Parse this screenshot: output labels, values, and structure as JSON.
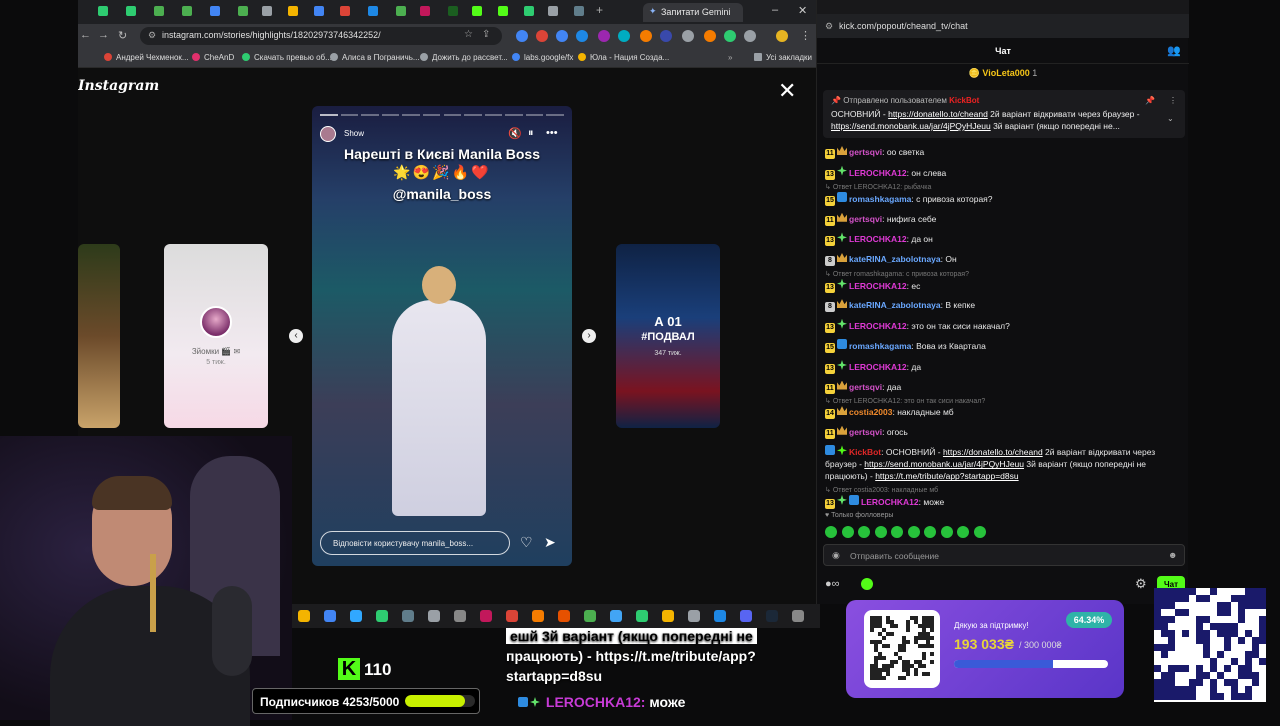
{
  "browser": {
    "active_tab": "Запитати Gemini",
    "url": "instagram.com/stories/highlights/18202973746342252/",
    "bookmarks": [
      "Андрей Чехменок...",
      "CheAnD",
      "Скачать превью об...",
      "Алиса в Пограничь...",
      "Дожить до рассвет...",
      "labs.google/fx",
      "Юла - Нация Созда...",
      "Усі закладки"
    ]
  },
  "instagram": {
    "logo": "Instagram",
    "close_icon": "close-icon",
    "left_preview": {
      "title": "Зйомки 🎬 ✉",
      "time": "5 тиж."
    },
    "right_preview": {
      "poster_line1": "А 01",
      "poster_line2": "#ПОДВАЛ",
      "time": "347 тиж."
    },
    "story": {
      "user": "Show",
      "title": "Нарешті в Києві Manila Boss",
      "emoji": "🌟😍🎉🔥❤️",
      "mention": "@manila_boss",
      "reply_placeholder": "Відповісти користувачу manila_boss...",
      "progress": {
        "segments": 12,
        "current": 1
      }
    }
  },
  "chat": {
    "chrome_url": "kick.com/popout/cheand_tv/chat",
    "header": "Чат",
    "gifter": {
      "name": "VioLeta000",
      "count": "1"
    },
    "pinned": {
      "by": "Отправлено пользователем",
      "bot": "KickBot",
      "text_main": "ОСНОВНИЙ - ",
      "link1": "https://donatello.to/cheand",
      "text_mid": " 2й варіант відкривати через браузер - ",
      "link2": "https://send.monobank.ua/jar/4jPQyHJeuu",
      "text_end": " 3й варіант (якщо попередні не..."
    },
    "messages": [
      {
        "badge": "11",
        "badge_color": "#f5d13a",
        "badge2": "crown",
        "user": "gertsqvi",
        "color": "#d452c9",
        "text": "оо светка"
      },
      {
        "badge": "13",
        "badge_color": "#f5d13a",
        "badge2": "star",
        "user": "LEROCHKA12",
        "color": "#e03ad6",
        "text": "он слева"
      },
      {
        "reply": "Ответ LEROCHKA12: рыбачка",
        "badge": "15",
        "badge_color": "#f5d13a",
        "badge2": "blue",
        "user": "romashkagama",
        "color": "#6aa8ff",
        "text": "с привоза которая?"
      },
      {
        "badge": "11",
        "badge_color": "#f5d13a",
        "badge2": "crown",
        "user": "gertsqvi",
        "color": "#d452c9",
        "text": "нифига себе"
      },
      {
        "badge": "13",
        "badge_color": "#f5d13a",
        "badge2": "star",
        "user": "LEROCHKA12",
        "color": "#e03ad6",
        "text": "да он"
      },
      {
        "badge": "8",
        "badge_color": "#cccccc",
        "badge2": "crown",
        "user": "kateRINA_zabolotnaya",
        "color": "#6aa8ff",
        "text": "Он"
      },
      {
        "reply": "Ответ romashkagama: с привоза которая?",
        "badge": "13",
        "badge_color": "#f5d13a",
        "badge2": "star",
        "user": "LEROCHKA12",
        "color": "#e03ad6",
        "text": "ес"
      },
      {
        "badge": "8",
        "badge_color": "#cccccc",
        "badge2": "crown",
        "user": "kateRINA_zabolotnaya",
        "color": "#6aa8ff",
        "text": "В кепке"
      },
      {
        "badge": "13",
        "badge_color": "#f5d13a",
        "badge2": "star",
        "user": "LEROCHKA12",
        "color": "#e03ad6",
        "text": "это он так сиси накачал?"
      },
      {
        "badge": "15",
        "badge_color": "#f5d13a",
        "badge2": "blue",
        "user": "romashkagama",
        "color": "#6aa8ff",
        "text": "Вова из Квартала"
      },
      {
        "badge": "13",
        "badge_color": "#f5d13a",
        "badge2": "star",
        "user": "LEROCHKA12",
        "color": "#e03ad6",
        "text": "да"
      },
      {
        "badge": "11",
        "badge_color": "#f5d13a",
        "badge2": "crown",
        "user": "gertsqvi",
        "color": "#d452c9",
        "text": "даа"
      },
      {
        "reply": "Ответ LEROCHKA12: это он так сиси накачал?",
        "badge": "14",
        "badge_color": "#f5d13a",
        "badge2": "crown",
        "user": "costia2003",
        "color": "#f08a2c",
        "text": "накладные мб"
      },
      {
        "badge": "11",
        "badge_color": "#f5d13a",
        "badge2": "crown",
        "user": "gertsqvi",
        "color": "#d452c9",
        "text": "огось"
      }
    ],
    "bot_message": {
      "user": "KickBot",
      "t1": "ОСНОВНИЙ - ",
      "l1": "https://donatello.to/cheand",
      "t2": " 2й варіант відкривати через браузер - ",
      "l2": "https://send.monobank.ua/jar/4jPQyHJeuu",
      "t3": " 3й варіант (якщо попередні не працюють) - ",
      "l3": "https://t.me/tribute/app?startapp=d8su"
    },
    "last_message": {
      "reply": "Ответ costia2003: накладные мб",
      "badge": "13",
      "user": "LEROCHKA12",
      "text": "може"
    },
    "followers_only": "Только фолловеры",
    "input_placeholder": "Отправить сообщение",
    "send_label": "Чат"
  },
  "overlay": {
    "kick_followers": "110",
    "kick_logo": "K",
    "subs_label": "Подписчиков 4253/5000",
    "subs_progress": 0.85,
    "caption_line1": "ешй 3й варіант (якщо попередні не",
    "caption_line2": "працюють) - https://t.me/tribute/app?",
    "caption_line3": "startapp=d8su",
    "caption_user": "LEROCHKA12:",
    "caption_text": "може",
    "donate": {
      "thanks": "Дякую за підтримку!",
      "percent": "64.34%",
      "amount": "193 033₴",
      "target": "/ 300 000₴",
      "progress": 0.6434
    }
  },
  "colors": {
    "kick_green": "#53fc18",
    "chat_bg": "#0e0e10",
    "donate_purple": "#7a45d8"
  }
}
